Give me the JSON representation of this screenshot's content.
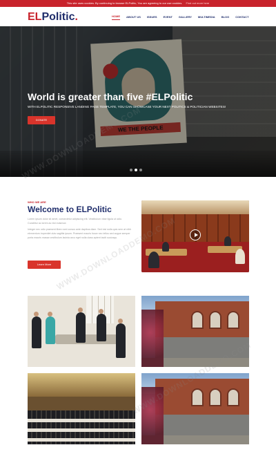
{
  "cookie_bar": {
    "text": "This site uses cookies. By continuing to browse ELPolitic, You are agreeing to our use cookies.",
    "link_label": "Find out more here"
  },
  "header": {
    "logo_prefix": "EL",
    "logo_name": "Politic",
    "logo_dot": ".",
    "nav": [
      "HOME",
      "ABOUT US",
      "ISSUES",
      "EVENT",
      "GALLERY",
      "MULTIMEDIA",
      "BLOG",
      "CONTACT"
    ],
    "active_nav": "HOME"
  },
  "hero": {
    "title": "World is greater than five #ELPolitic",
    "subtitle": "WITH ELPOLITIC RESPONSIVE LANDING PAGE TEMPLATE, YOU CAN SHOWCASE YOUR NEXT POLITICS & POLITICIAN WEBSITES!",
    "button_label": "DONATE",
    "poster_text": "WE THE PEOPLE",
    "slides": 3,
    "active_slide": 2
  },
  "about": {
    "kicker": "WHO WE ARE",
    "title": "Welcome to ELPolitic",
    "paragraphs": [
      "Lorem ipsum dolor sit amet, consectetur adipiscing elit. Vestibulum vitae ligula ut odio. Curabitur ac lorem ac nisl euismod.",
      "Integer nec odio praesent libero sed cursus ante dapibus diam. Sed nisi nulla quis sem at nibh elementum imperdiet duis sagittis ipsum. Praesent mauris fusce nec tellus sed augue semper porta mauris massa vestibulum lacinia arcu eget nulla class aptent taciti sociosqu."
    ],
    "button_label": "Learn More"
  },
  "watermark_text": "WWW.DOWNLOADDEMO.COM",
  "colors": {
    "brand_red": "#c8232c",
    "brand_navy": "#1f2d6b"
  }
}
